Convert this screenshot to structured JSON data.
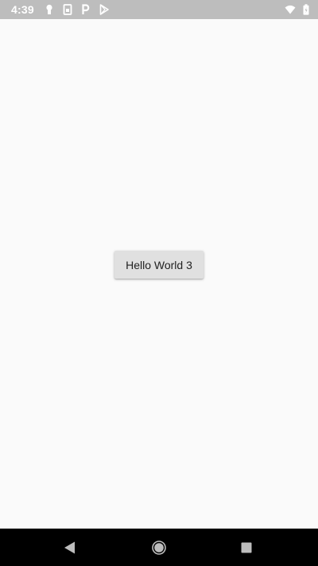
{
  "status_bar": {
    "time": "4:39",
    "notification_icons": [
      "keyhole-icon",
      "sim-card-icon",
      "parking-icon",
      "play-store-icon"
    ],
    "system_icons": [
      "wifi-icon",
      "battery-icon"
    ],
    "background_color": "#bdbdbd"
  },
  "main": {
    "button_label": "Hello World 3",
    "background_color": "#fafafa"
  },
  "nav_bar": {
    "buttons": [
      "back-icon",
      "home-icon",
      "recents-icon"
    ],
    "background_color": "#000000"
  }
}
